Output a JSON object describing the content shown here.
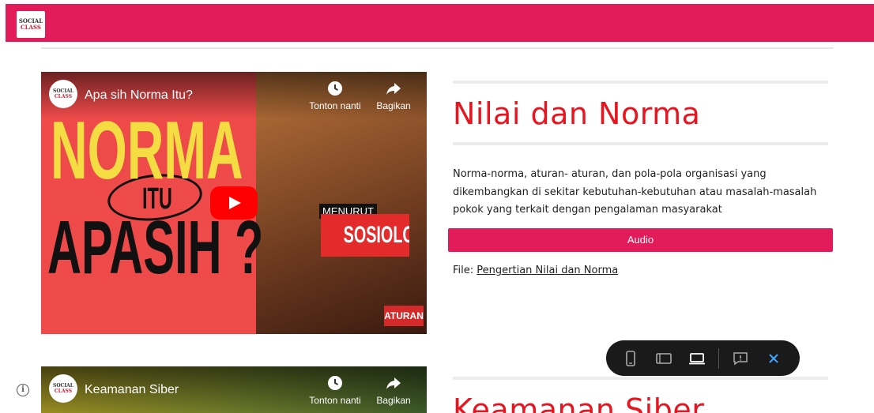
{
  "header": {
    "logo": {
      "line1": "SOCIAL",
      "line2": "CLASS"
    },
    "color": "#e21b5a"
  },
  "video_actions": {
    "watch_later": "Tonton nanti",
    "share": "Bagikan"
  },
  "sections": [
    {
      "video": {
        "channel_logo": [
          "SOCIAL",
          "CLASS"
        ],
        "title": "Apa sih Norma Itu?",
        "thumb_text": {
          "norma": "NORMA",
          "itu": "ITU",
          "apasih": "APASIH ?",
          "menurut": "MENURUT",
          "sosiologi": "SOSIOLOGI",
          "aturan": "ATURAN"
        }
      },
      "heading": "Nilai dan Norma",
      "description": "Norma-norma, aturan- aturan, dan pola-pola organisasi yang dikembangkan di sekitar kebutuhan-kebutuhan atau masalah-masalah pokok yang terkait dengan pengalaman masyarakat",
      "audio_label": "Audio",
      "file_label": "File:",
      "file_link": "Pengertian Nilai dan Norma"
    },
    {
      "video": {
        "channel_logo": [
          "SOCIAL",
          "CLASS"
        ],
        "title": "Keamanan Siber"
      },
      "heading": "Keamanan Siber"
    }
  ],
  "floating_toolbar": {
    "buttons": [
      "phone-icon",
      "tablet-icon",
      "laptop-icon",
      "feedback-icon",
      "close-icon"
    ]
  },
  "colors": {
    "accent": "#e21b5a",
    "heading": "#e8141f",
    "toolbar_bg": "#1a1a1a",
    "close": "#3ea6ff"
  }
}
